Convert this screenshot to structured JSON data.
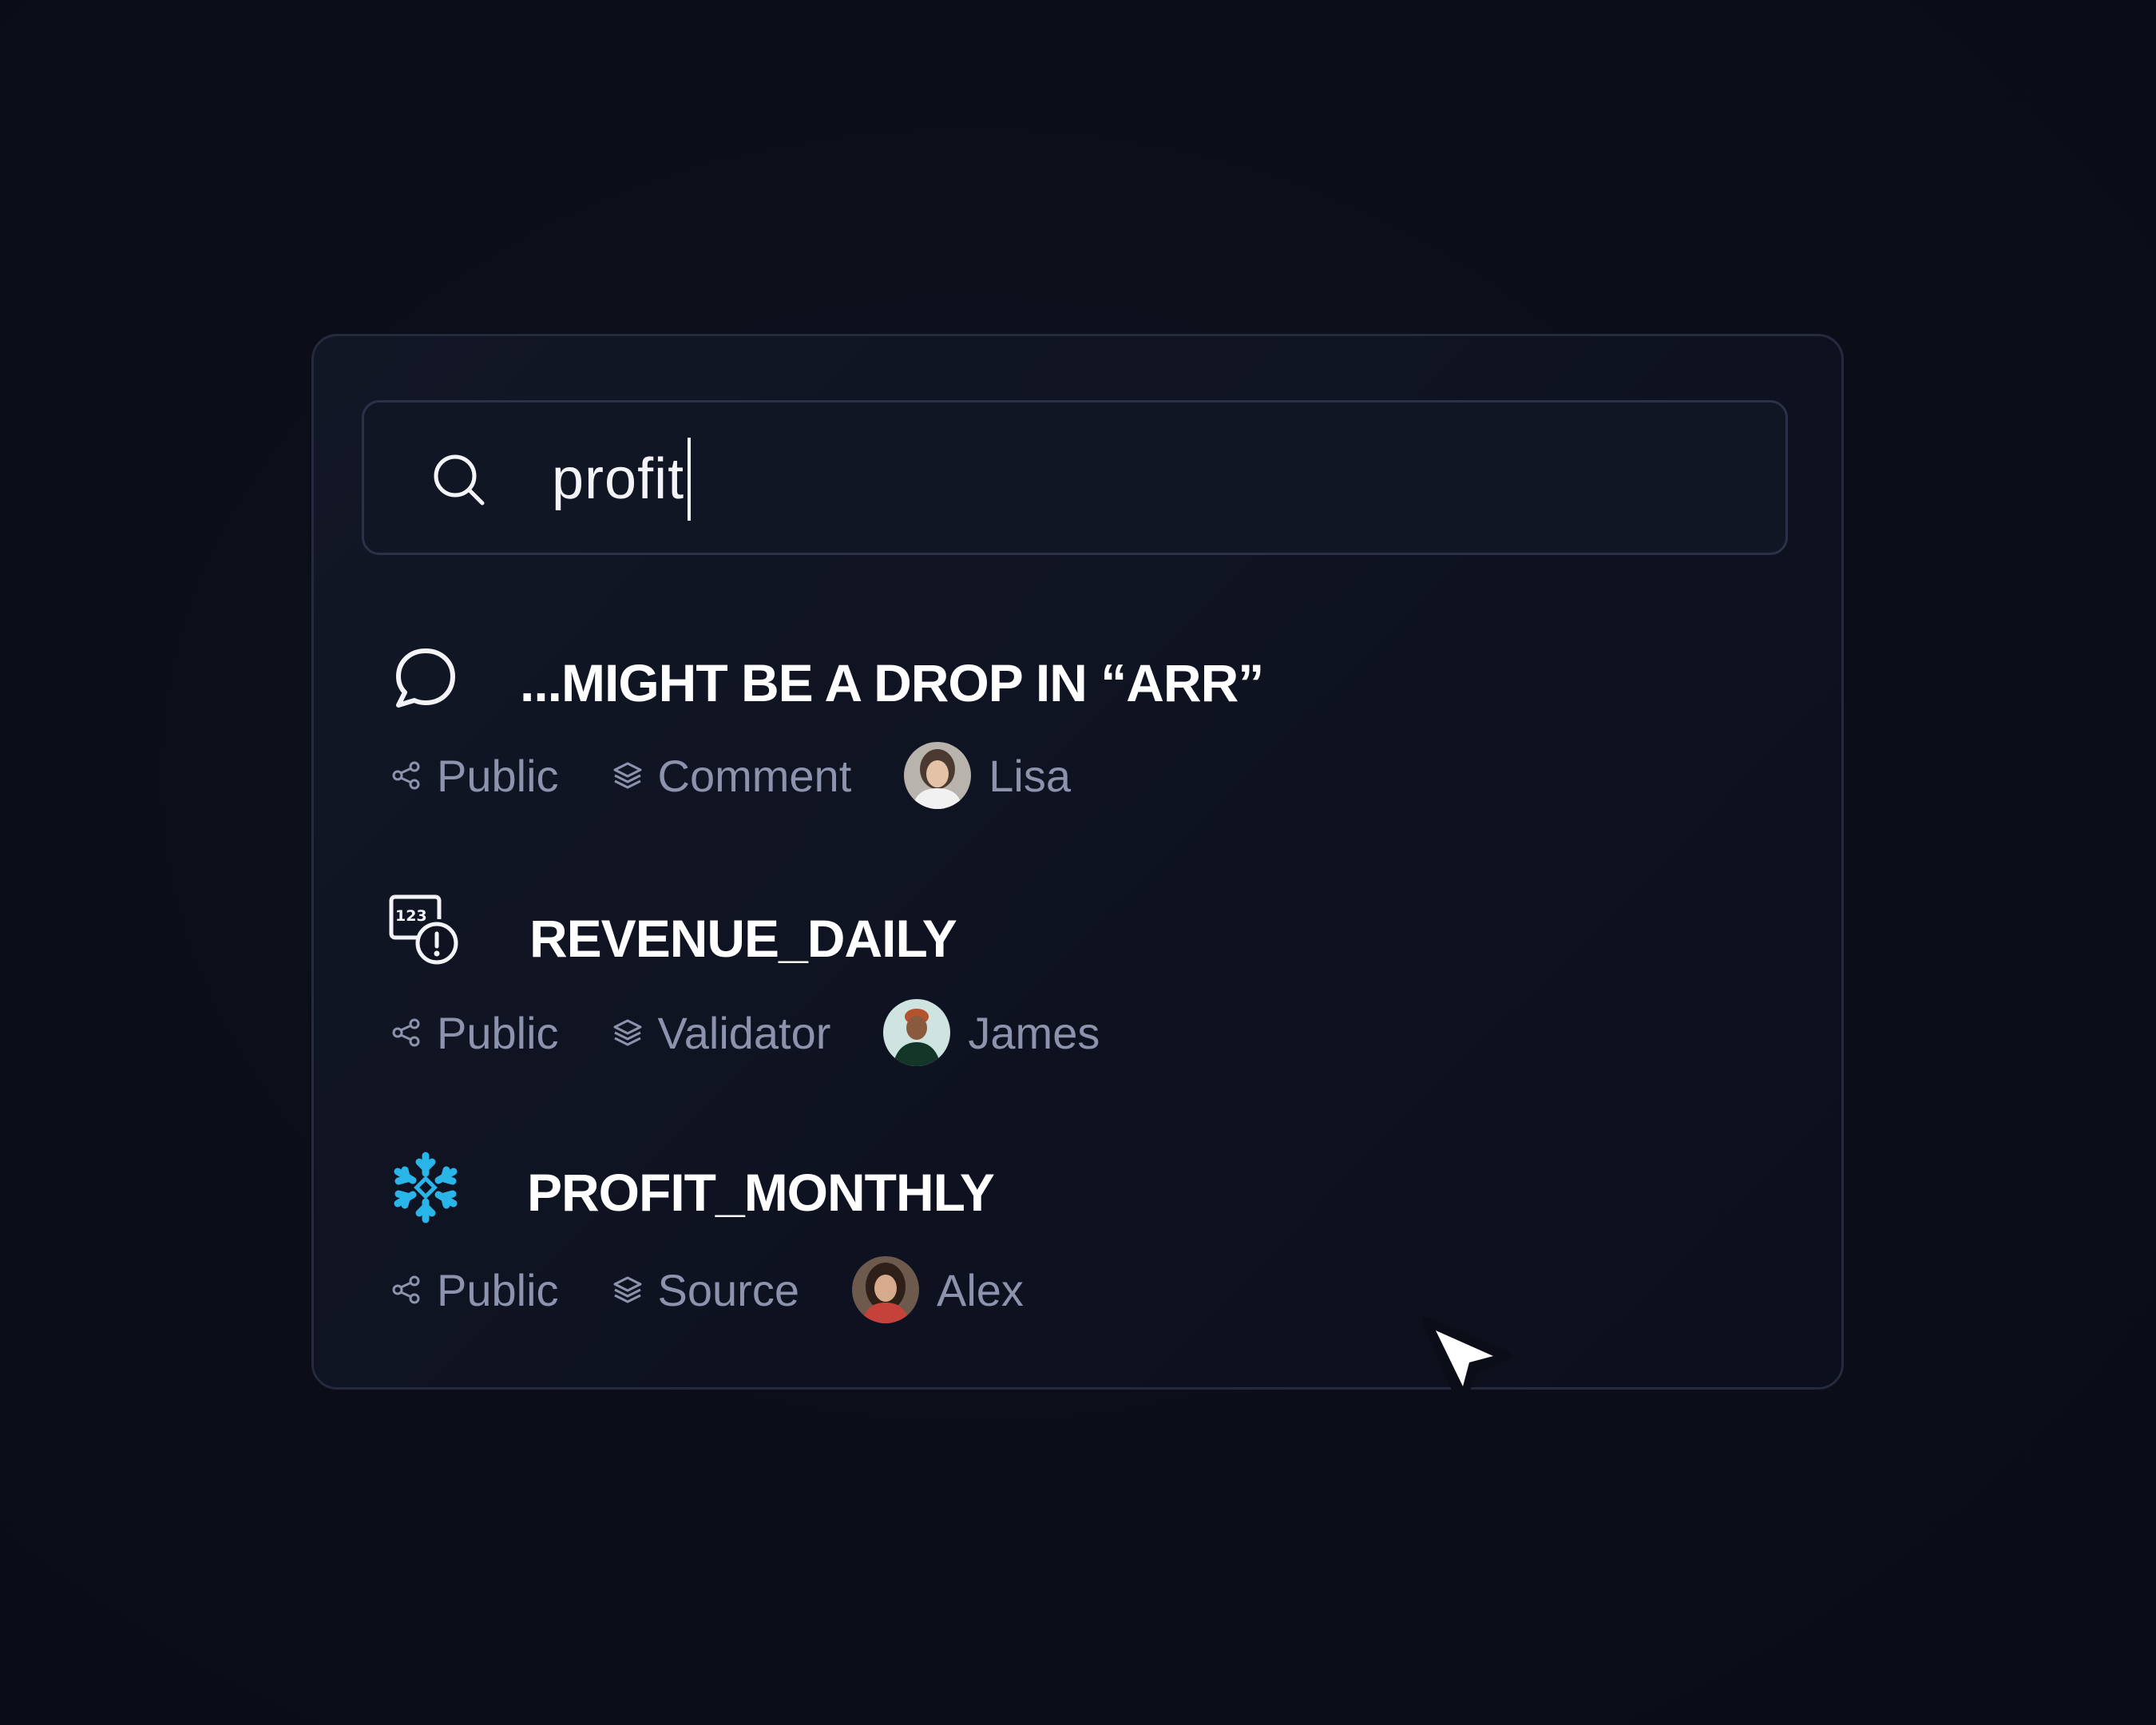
{
  "search": {
    "query": "profit",
    "icon": "search-icon"
  },
  "results": [
    {
      "title": "...MIGHT BE A DROP IN “ARR”",
      "icon": "comment-bubble-icon",
      "visibility": "Public",
      "type": "Comment",
      "owner": "Lisa"
    },
    {
      "title": "REVENUE_DAILY",
      "icon": "validator-icon",
      "visibility": "Public",
      "type": "Validator",
      "owner": "James"
    },
    {
      "title": "PROFIT_MONTHLY",
      "icon": "snowflake-icon",
      "visibility": "Public",
      "type": "Source",
      "owner": "Alex"
    }
  ],
  "colors": {
    "background": "#0b0e18",
    "panel_border": "#252a3e",
    "title_text": "#ffffff",
    "meta_text": "#8d93ad",
    "snowflake": "#29b5e8"
  }
}
